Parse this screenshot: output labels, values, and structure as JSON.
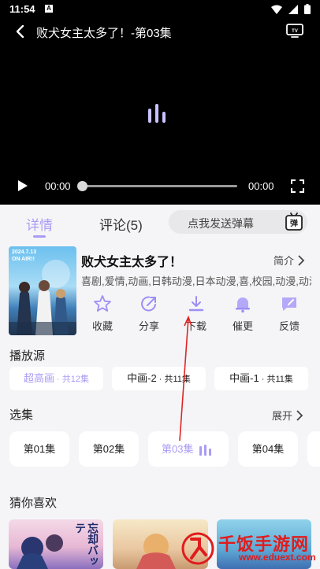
{
  "status_bar": {
    "time": "11:54",
    "app_badge": "A"
  },
  "player": {
    "title": "败犬女主太多了！-第03集",
    "current_time": "00:00",
    "total_time": "00:00",
    "progress": 0
  },
  "tabs": [
    {
      "label": "详情",
      "active": true
    },
    {
      "label": "评论(5)",
      "active": false
    }
  ],
  "danmaku": {
    "placeholder": "点我发送弹幕",
    "icon_label": "弹"
  },
  "show": {
    "title": "败犬女主太多了！",
    "intro_label": "简介",
    "tags": "喜剧,爱情,动画,日韩动漫,日本动漫,喜,校园,动漫,动漫",
    "poster_text": "2024.7.13\nON AIR!!"
  },
  "actions": [
    {
      "label": "收藏",
      "icon": "star-icon"
    },
    {
      "label": "分享",
      "icon": "share-icon"
    },
    {
      "label": "下载",
      "icon": "download-icon"
    },
    {
      "label": "催更",
      "icon": "bell-icon"
    },
    {
      "label": "反馈",
      "icon": "feedback-icon"
    }
  ],
  "sources": {
    "heading": "播放源",
    "items": [
      {
        "name": "超高画",
        "count": " · 共12集",
        "active": true
      },
      {
        "name": "中画-2",
        "count": " · 共11集",
        "active": false
      },
      {
        "name": "中画-1",
        "count": " · 共11集",
        "active": false
      }
    ]
  },
  "episodes": {
    "heading": "选集",
    "expand_label": "展开",
    "items": [
      {
        "label": "第01集",
        "active": false
      },
      {
        "label": "第02集",
        "active": false
      },
      {
        "label": "第03集",
        "active": true
      },
      {
        "label": "第04集",
        "active": false
      }
    ]
  },
  "recommend": {
    "heading": "猜你喜欢",
    "poster1_text": "忘却バッテ"
  },
  "watermark": {
    "title": "千饭手游网",
    "url": "www.eduext.com"
  },
  "colors": {
    "accent": "#a99cf5",
    "watermark": "#e01c1c",
    "player_bg": "#000000",
    "page_bg": "#f5f5f7"
  }
}
